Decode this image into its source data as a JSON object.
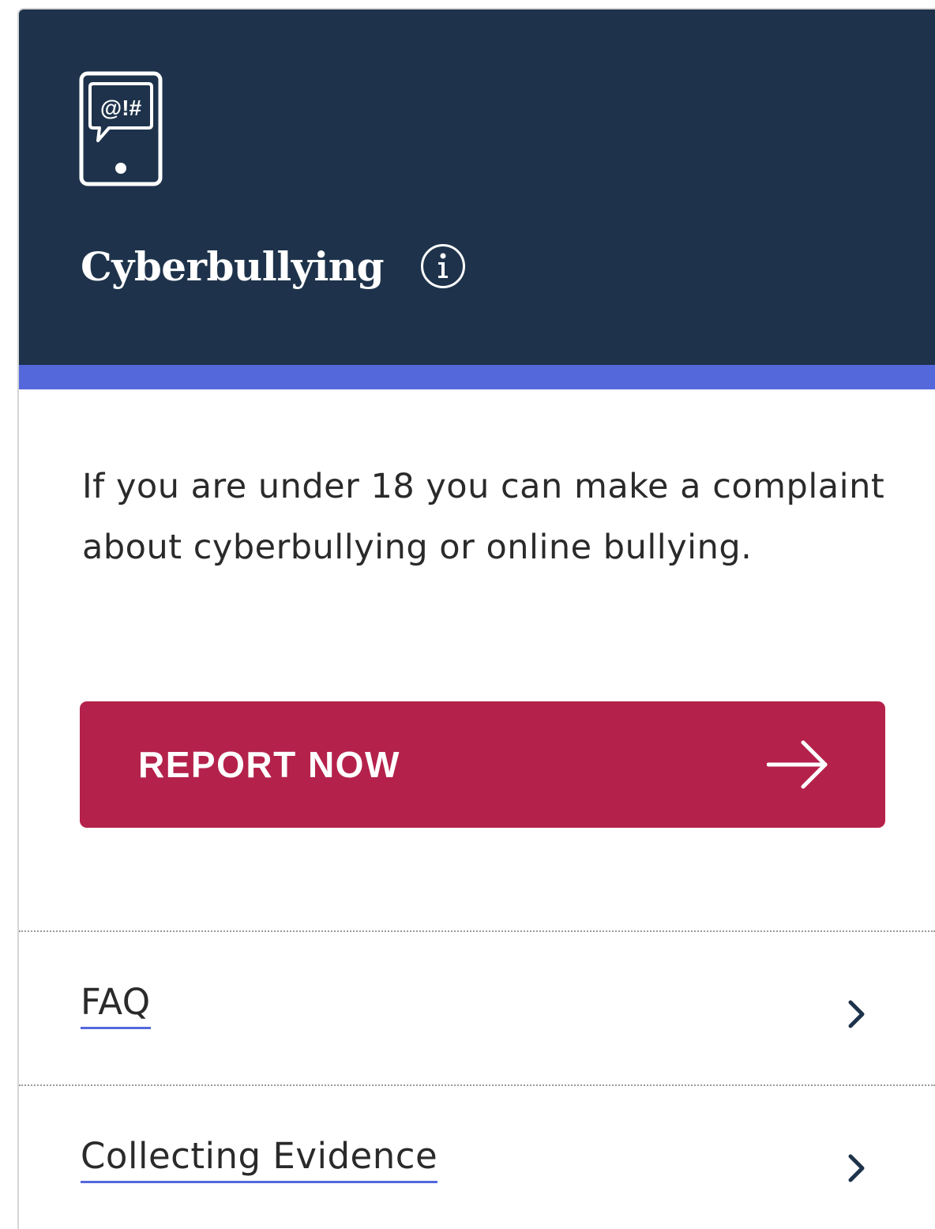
{
  "header": {
    "icon": "phone-speech-bubble-icon",
    "icon_text": "@!#",
    "title": "Cyberbullying",
    "info_icon": "info-icon",
    "background_color": "#1e334b",
    "accent_color": "#5468db"
  },
  "content": {
    "description": "If you are under 18 you can make a complaint about cyberbullying or online bullying."
  },
  "report_button": {
    "label": "REPORT NOW",
    "icon": "arrow-right-icon",
    "color": "#b4224b"
  },
  "links": [
    {
      "label": "FAQ",
      "icon": "chevron-right-icon"
    },
    {
      "label": "Collecting Evidence",
      "icon": "chevron-right-icon"
    }
  ]
}
